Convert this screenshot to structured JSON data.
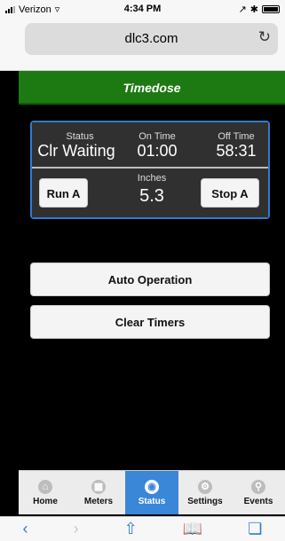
{
  "status_bar": {
    "carrier": "Verizon",
    "time": "4:34 PM"
  },
  "browser": {
    "url": "dlc3.com",
    "reload_icon": "reload-icon"
  },
  "app": {
    "title": "Timedose",
    "accent_green": "#1d7a12",
    "accent_blue": "#2f7bd0"
  },
  "panel": {
    "status_label": "Status",
    "status_value": "Clr Waiting",
    "on_time_label": "On Time",
    "on_time_value": "01:00",
    "off_time_label": "Off Time",
    "off_time_value": "58:31",
    "inches_label": "Inches",
    "inches_value": "5.3",
    "run_button": "Run A",
    "stop_button": "Stop A"
  },
  "actions": {
    "auto_operation": "Auto Operation",
    "clear_timers": "Clear Timers"
  },
  "tabs": [
    {
      "label": "Home",
      "icon": "home-icon"
    },
    {
      "label": "Meters",
      "icon": "meters-icon"
    },
    {
      "label": "Status",
      "icon": "status-icon",
      "active": true
    },
    {
      "label": "Settings",
      "icon": "settings-icon"
    },
    {
      "label": "Events",
      "icon": "events-icon"
    }
  ],
  "safari_toolbar": {
    "back_icon": "back-icon",
    "forward_icon": "forward-icon",
    "share_icon": "share-icon",
    "bookmarks_icon": "bookmarks-icon",
    "tabs_icon": "tabs-icon"
  }
}
